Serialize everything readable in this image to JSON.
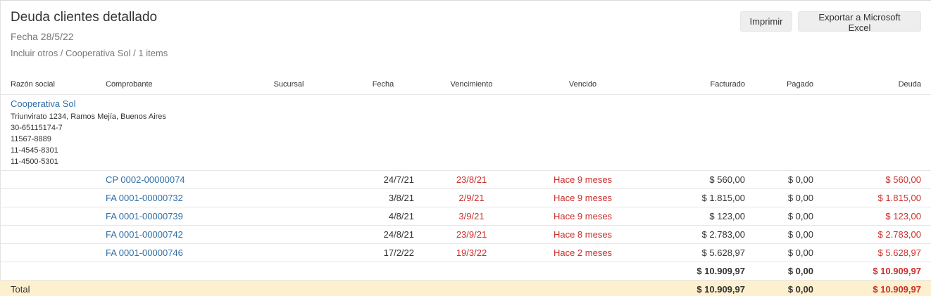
{
  "report": {
    "title": "Deuda clientes detallado",
    "date_label": "Fecha 28/5/22",
    "filter_label": "Incluir otros / Cooperativa Sol / 1 items"
  },
  "toolbar": {
    "print_label": "Imprimir",
    "excel_label": "Exportar a Microsoft Excel"
  },
  "table": {
    "columns": {
      "razon_social": "Razón social",
      "comprobante": "Comprobante",
      "sucursal": "Sucursal",
      "fecha": "Fecha",
      "vencimiento": "Vencimiento",
      "vencido": "Vencido",
      "facturado": "Facturado",
      "pagado": "Pagado",
      "deuda": "Deuda"
    },
    "customer": {
      "name": "Cooperativa Sol",
      "address": "Triunvirato 1234, Ramos Mejía, Buenos Aires",
      "tax_id": "30-65115174-7",
      "phone1": "11567-8889",
      "phone2": "11-4545-8301",
      "phone3": "11-4500-5301"
    },
    "rows": [
      {
        "comprobante": "CP 0002-00000074",
        "fecha": "24/7/21",
        "vencimiento": "23/8/21",
        "vencido": "Hace 9 meses",
        "facturado": "$ 560,00",
        "pagado": "$ 0,00",
        "deuda": "$ 560,00"
      },
      {
        "comprobante": "FA 0001-00000732",
        "fecha": "3/8/21",
        "vencimiento": "2/9/21",
        "vencido": "Hace 9 meses",
        "facturado": "$ 1.815,00",
        "pagado": "$ 0,00",
        "deuda": "$ 1.815,00"
      },
      {
        "comprobante": "FA 0001-00000739",
        "fecha": "4/8/21",
        "vencimiento": "3/9/21",
        "vencido": "Hace 9 meses",
        "facturado": "$ 123,00",
        "pagado": "$ 0,00",
        "deuda": "$ 123,00"
      },
      {
        "comprobante": "FA 0001-00000742",
        "fecha": "24/8/21",
        "vencimiento": "23/9/21",
        "vencido": "Hace 8 meses",
        "facturado": "$ 2.783,00",
        "pagado": "$ 0,00",
        "deuda": "$ 2.783,00"
      },
      {
        "comprobante": "FA 0001-00000746",
        "fecha": "17/2/22",
        "vencimiento": "19/3/22",
        "vencido": "Hace 2 meses",
        "facturado": "$ 5.628,97",
        "pagado": "$ 0,00",
        "deuda": "$ 5.628,97"
      }
    ],
    "subtotal": {
      "facturado": "$ 10.909,97",
      "pagado": "$ 0,00",
      "deuda": "$ 10.909,97"
    },
    "total": {
      "label": "Total",
      "facturado": "$ 10.909,97",
      "pagado": "$ 0,00",
      "deuda": "$ 10.909,97"
    }
  },
  "colors": {
    "link": "#2f6fa7",
    "overdue": "#c9302c",
    "total_bg": "#fcf0ce"
  }
}
